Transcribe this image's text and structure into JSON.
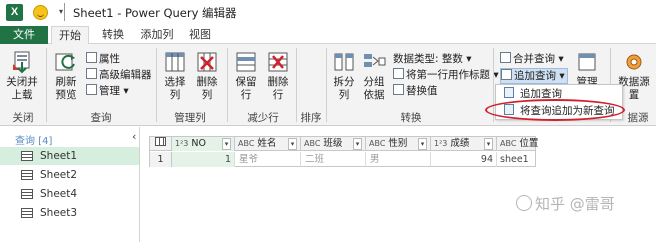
{
  "window": {
    "title": "Sheet1 - Power Query 编辑器",
    "app_logo": "X",
    "accent": "#217346"
  },
  "tabs": [
    "文件",
    "开始",
    "转换",
    "添加列",
    "视图"
  ],
  "ribbon": {
    "close_load": [
      "关闭并",
      "上载"
    ],
    "refresh_preview": [
      "刷新",
      "预览"
    ],
    "properties": "属性",
    "advanced_editor": "高级编辑器",
    "manage": "管理",
    "choose_cols": [
      "选择",
      "列"
    ],
    "remove_cols": [
      "删除",
      "列"
    ],
    "keep_rows": [
      "保留",
      "行"
    ],
    "remove_rows": [
      "删除",
      "行"
    ],
    "split_col": [
      "拆分",
      "列"
    ],
    "group_by": [
      "分组",
      "依据"
    ],
    "data_type": "数据类型: 整数",
    "first_row_headers": "将第一行用作标题",
    "replace_values": "替换值",
    "merge_queries": "合并查询",
    "append_queries": "追加查询",
    "manage_params_partial": "管理",
    "data_source_partial": "数据源",
    "settings_partial": "置",
    "group_labels": {
      "close": "关闭",
      "query": "查询",
      "manage_cols": "管理列",
      "reduce_rows": "减少行",
      "sort": "排序",
      "transform": "转换",
      "datasource": "据源"
    }
  },
  "append_menu": {
    "items": [
      "追加查询",
      "将查询追加为新查询"
    ],
    "highlight_color": "#d0202e"
  },
  "queries_pane": {
    "header": "查询 [4]",
    "items": [
      "Sheet1",
      "Sheet2",
      "Sheet4",
      "Sheet3"
    ],
    "selected": "Sheet1"
  },
  "grid": {
    "columns": [
      {
        "type": "1²3",
        "name": "NO"
      },
      {
        "type": "ABC",
        "name": "姓名"
      },
      {
        "type": "ABC",
        "name": "班级"
      },
      {
        "type": "ABC",
        "name": "性别"
      },
      {
        "type": "1²3",
        "name": "成绩"
      },
      {
        "type": "ABC",
        "name": "位置"
      }
    ],
    "rows": [
      {
        "index": "1",
        "cells": [
          "1",
          "星爷",
          "二班",
          "男",
          "94",
          "shee1"
        ]
      }
    ]
  },
  "watermark": "知乎 @雷哥"
}
